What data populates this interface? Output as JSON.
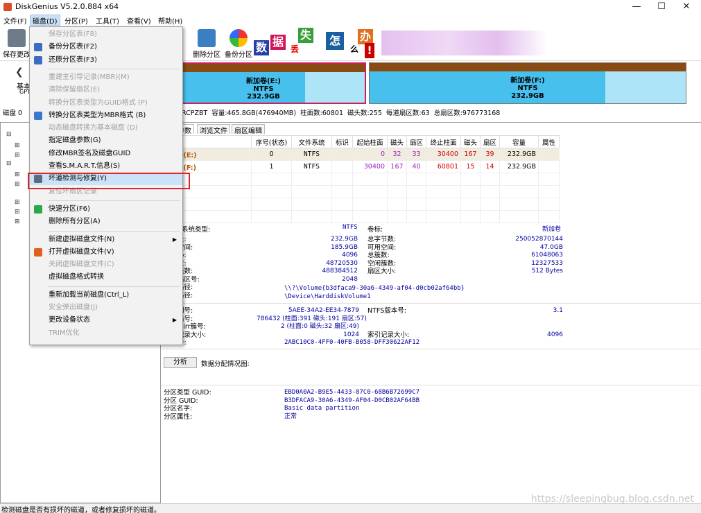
{
  "window": {
    "title": "DiskGenius V5.2.0.884 x64"
  },
  "menubar": [
    "文件(F)",
    "磁盘(D)",
    "分区(P)",
    "工具(T)",
    "查看(V)",
    "帮助(H)"
  ],
  "toolbar": {
    "save": "保存更改",
    "delete": "删除分区",
    "backup": "备份分区"
  },
  "ad_tiles": [
    "数",
    "据",
    "丢",
    "失",
    "怎",
    "么",
    "办",
    "!"
  ],
  "left_stub": {
    "basic": "基本",
    "gpt": "GPT",
    "disk": "磁盘 0"
  },
  "partitions": [
    {
      "name": "新加卷(E:)",
      "fs": "NTFS",
      "size": "232.9GB"
    },
    {
      "name": "新加卷(F:)",
      "fs": "NTFS",
      "size": "232.9GB"
    }
  ],
  "disk_info": "RCPZBT  容量:465.8GB(476940MB)  柱面数:60801  磁头数:255  每道扇区数:63  总扇区数:976773168",
  "tabs": [
    "参数",
    "浏览文件",
    "扇区编辑"
  ],
  "table": {
    "headers": [
      "",
      "序号(状态)",
      "文件系统",
      "标识",
      "起始柱面",
      "磁头",
      "扇区",
      "终止柱面",
      "磁头",
      "扇区",
      "容量",
      "属性"
    ],
    "rows": [
      [
        "新加卷(E:)",
        "0",
        "NTFS",
        "",
        "0",
        "32",
        "33",
        "30400",
        "167",
        "39",
        "232.9GB",
        ""
      ],
      [
        "新加卷(F:)",
        "1",
        "NTFS",
        "",
        "30400",
        "167",
        "40",
        "60801",
        "15",
        "14",
        "232.9GB",
        ""
      ]
    ]
  },
  "details": {
    "fs_type_label": "系统类型:",
    "fs_type": "NTFS",
    "vol_label_k": "卷标:",
    "vol_label": "新加卷",
    "left_labels": [
      "量:",
      "空间:",
      "小:",
      "数:",
      "簇数:",
      "扇区号:",
      "路径:",
      "路径:"
    ],
    "left_vals": [
      "232.9GB",
      "185.9GB",
      "4096",
      "48720530",
      "488384512",
      "2048"
    ],
    "right_labels": [
      "总字节数:",
      "可用空间:",
      "总簇数:",
      "空闲簇数:",
      "扇区大小:"
    ],
    "right_vals": [
      "250052870144",
      "47.0GB",
      "61048063",
      "12327533",
      "512 Bytes"
    ],
    "path1": "\\\\?\\Volume{b3dfaca9-30a6-4349-af04-d0cb02af64bb}",
    "path2": "\\Device\\HarddiskVolume1",
    "block2_left": [
      "列号:",
      "扇号:",
      "Mirr簇号:",
      "记录大小:",
      "号:"
    ],
    "block2_left_vals": [
      "5AEE-34A2-EE34-7879",
      "786432 (柱面:391 磁头:191 扇区:57)",
      "2 (柱面:0 磁头:32 扇区:49)",
      "1024",
      "2ABC10C0-4FF0-40FB-B058-DFF30622AF12"
    ],
    "block2_right": [
      "NTFS版本号:",
      "",
      "",
      "索引记录大小:"
    ],
    "block2_right_vals": [
      "3.1",
      "",
      "",
      "4096"
    ],
    "analyze_btn": "分析",
    "analyze_label": "数据分配情况图:",
    "guid_labels": [
      "分区类型 GUID:",
      "分区 GUID:",
      "分区名字:",
      "分区属性:"
    ],
    "guid_vals": [
      "EBD0A0A2-B9E5-4433-87C0-68B6B72699C7",
      "B3DFACA9-30A6-4349-AF04-D0CB02AF64BB",
      "Basic data partition",
      "正常"
    ]
  },
  "dropdown": [
    {
      "label": "保存分区表(F8)",
      "dis": true
    },
    {
      "label": "备份分区表(F2)",
      "dis": false
    },
    {
      "label": "还原分区表(F3)",
      "dis": false
    },
    {
      "sep": true
    },
    {
      "label": "重建主引导记录(MBR)(M)",
      "dis": true
    },
    {
      "label": "清除保留扇区(E)",
      "dis": true
    },
    {
      "label": "转换分区表类型为GUID格式 (P)",
      "dis": true
    },
    {
      "label": "转换分区表类型为MBR格式 (B)",
      "dis": false
    },
    {
      "label": "动态磁盘转换为基本磁盘 (D)",
      "dis": true
    },
    {
      "label": "指定磁盘参数(G)",
      "dis": false
    },
    {
      "label": "修改MBR签名及磁盘GUID",
      "dis": false
    },
    {
      "label": "查看S.M.A.R.T.信息(S)",
      "dis": false
    },
    {
      "label": "坏道检测与修复(Y)",
      "dis": false,
      "hl": true
    },
    {
      "label": "复位坏扇区记录",
      "dis": true
    },
    {
      "sep": true
    },
    {
      "label": "快速分区(F6)",
      "dis": false
    },
    {
      "label": "删除所有分区(A)",
      "dis": false
    },
    {
      "sep": true
    },
    {
      "label": "新建虚拟磁盘文件(N)",
      "dis": false,
      "sub": true
    },
    {
      "label": "打开虚拟磁盘文件(V)",
      "dis": false
    },
    {
      "label": "关闭虚拟磁盘文件(C)",
      "dis": true
    },
    {
      "label": "虚拟磁盘格式转换",
      "dis": false
    },
    {
      "sep": true
    },
    {
      "label": "重新加载当前磁盘(Ctrl_L)",
      "dis": false
    },
    {
      "label": "安全弹出磁盘(J)",
      "dis": true
    },
    {
      "label": "更改设备状态",
      "dis": false,
      "sub": true
    },
    {
      "label": "TRIM优化",
      "dis": true
    }
  ],
  "status": "检测磁盘是否有损坏的磁道，或者修复损坏的磁道。",
  "watermark": "https://sleepingbug.blog.csdn.net"
}
